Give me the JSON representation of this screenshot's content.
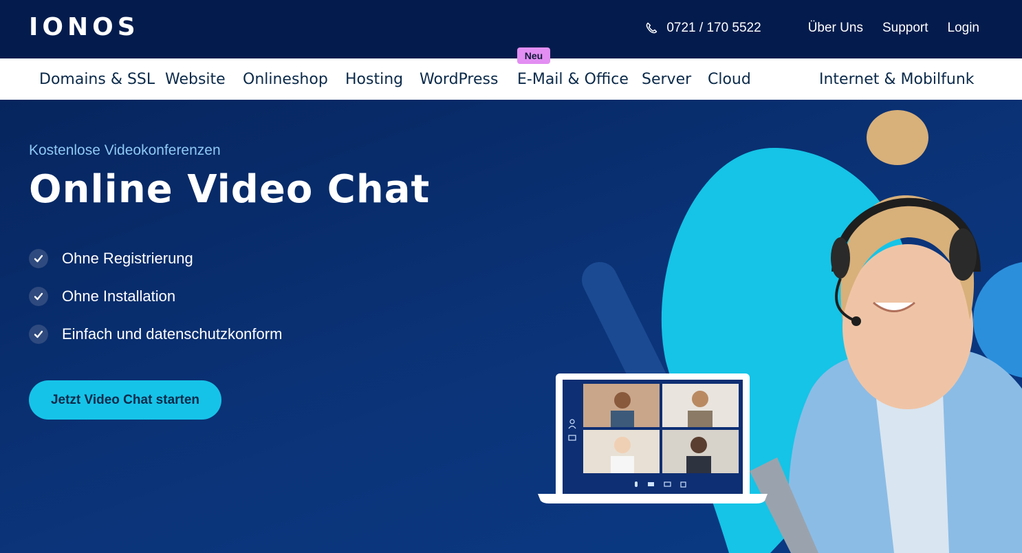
{
  "brand": {
    "logo_text": "IONOS"
  },
  "topbar": {
    "phone": "0721 / 170 5522",
    "links": [
      "Über Uns",
      "Support",
      "Login"
    ]
  },
  "nav": {
    "items": [
      "Domains & SSL",
      "Website",
      "Onlineshop",
      "Hosting",
      "WordPress",
      "E-Mail & Office",
      "Server",
      "Cloud",
      "Internet & Mobilfunk"
    ],
    "badge": "Neu"
  },
  "hero": {
    "eyebrow": "Kostenlose Videokonferenzen",
    "title": "Online Video Chat",
    "features": [
      "Ohne Registrierung",
      "Ohne Installation",
      "Einfach und datenschutzkonform"
    ],
    "cta": "Jetzt Video Chat starten"
  },
  "colors": {
    "topbar_bg": "#041c4d",
    "hero_bg": "#0b3479",
    "accent": "#16c3e8",
    "badge": "#e28ef2",
    "eyebrow": "#8ec8f4"
  },
  "icons": [
    "phone-icon",
    "check-icon",
    "mic-icon",
    "camera-icon",
    "screen-share-icon",
    "leave-icon",
    "participants-icon",
    "chat-icon"
  ]
}
